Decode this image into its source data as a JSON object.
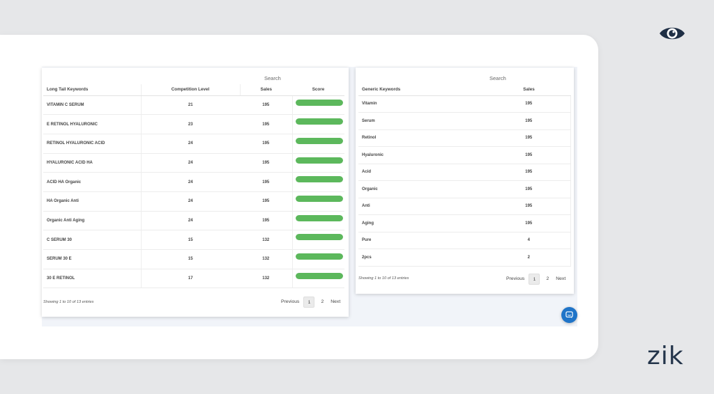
{
  "brand": {
    "wordmark": "zik",
    "eye_icon": "eye-icon",
    "color": "#23344a"
  },
  "colors": {
    "score_bar": "#5cb85c",
    "chat_button": "#1f74c8"
  },
  "long_tail_table": {
    "search_label": "Search",
    "columns": [
      "Long Tail Keywords",
      "Competition Level",
      "Sales",
      "Score"
    ],
    "rows": [
      {
        "keyword": "VITAMIN C SERUM",
        "competition": "21",
        "sales": "195",
        "score": 1.0
      },
      {
        "keyword": "E RETINOL HYALURONIC",
        "competition": "23",
        "sales": "195",
        "score": 1.0
      },
      {
        "keyword": "RETINOL HYALURONIC ACID",
        "competition": "24",
        "sales": "195",
        "score": 1.0
      },
      {
        "keyword": "HYALURONIC ACID HA",
        "competition": "24",
        "sales": "195",
        "score": 1.0
      },
      {
        "keyword": "ACID HA Organic",
        "competition": "24",
        "sales": "195",
        "score": 1.0
      },
      {
        "keyword": "HA Organic Anti",
        "competition": "24",
        "sales": "195",
        "score": 1.0
      },
      {
        "keyword": "Organic Anti Aging",
        "competition": "24",
        "sales": "195",
        "score": 1.0
      },
      {
        "keyword": "C SERUM 30",
        "competition": "15",
        "sales": "132",
        "score": 1.0
      },
      {
        "keyword": "SERUM 30 E",
        "competition": "15",
        "sales": "132",
        "score": 1.0
      },
      {
        "keyword": "30 E RETINOL",
        "competition": "17",
        "sales": "132",
        "score": 1.0
      }
    ],
    "info": "Showing 1 to 10 of 13 entries",
    "pagination": {
      "previous": "Previous",
      "pages": [
        "1",
        "2"
      ],
      "active": "1",
      "next": "Next"
    }
  },
  "generic_table": {
    "search_label": "Search",
    "columns": [
      "Generic Keywords",
      "Sales"
    ],
    "rows": [
      {
        "keyword": "Vitamin",
        "sales": "195"
      },
      {
        "keyword": "Serum",
        "sales": "195"
      },
      {
        "keyword": "Retinol",
        "sales": "195"
      },
      {
        "keyword": "Hyaluronic",
        "sales": "195"
      },
      {
        "keyword": "Acid",
        "sales": "195"
      },
      {
        "keyword": "Organic",
        "sales": "195"
      },
      {
        "keyword": "Anti",
        "sales": "195"
      },
      {
        "keyword": "Aging",
        "sales": "195"
      },
      {
        "keyword": "Pure",
        "sales": "4"
      },
      {
        "keyword": "2pcs",
        "sales": "2"
      }
    ],
    "info": "Showing 1 to 10 of 13 entries",
    "pagination": {
      "previous": "Previous",
      "pages": [
        "1",
        "2"
      ],
      "active": "1",
      "next": "Next"
    }
  },
  "chat": {
    "icon": "chat-bubble-icon"
  }
}
